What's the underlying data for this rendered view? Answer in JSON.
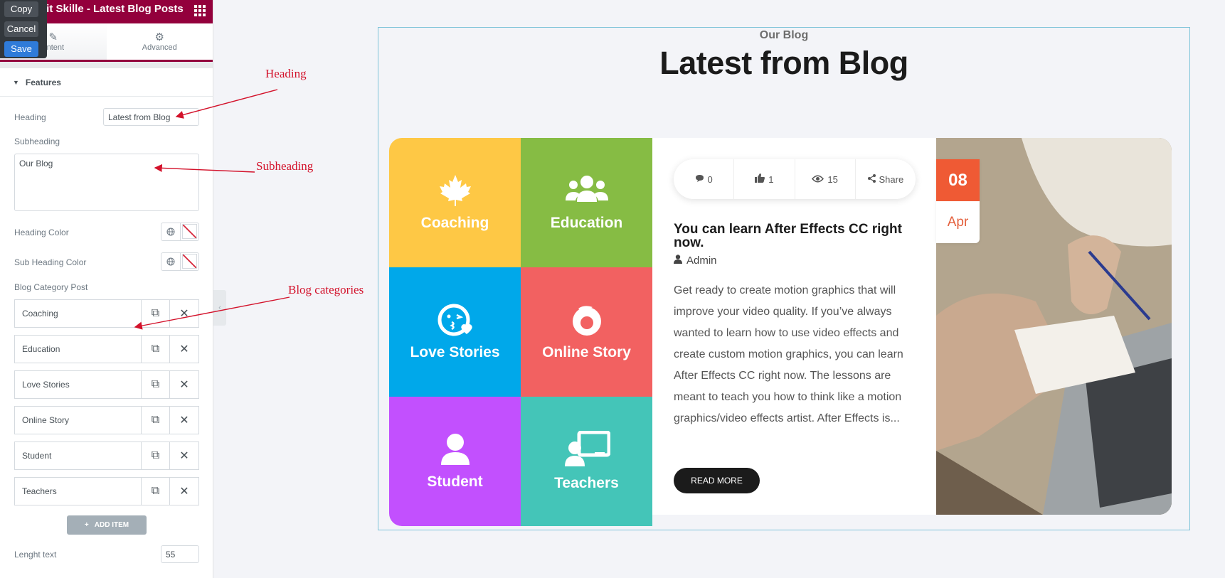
{
  "panel": {
    "title": "Edit Skille - Latest Blog Posts",
    "title_visible": "dit Skille - Latest Blog Posts",
    "action_menu": {
      "copy": "Copy",
      "cancel": "Cancel",
      "save": "Save"
    },
    "tabs": [
      {
        "label": "Content",
        "visible": "ontent"
      },
      {
        "label": "Advanced"
      }
    ],
    "section": "Features",
    "heading_label": "Heading",
    "heading_value": "Latest from Blog",
    "subheading_label": "Subheading",
    "subheading_value": "Our Blog",
    "heading_color_label": "Heading Color",
    "sub_heading_color_label": "Sub Heading Color",
    "blog_category_label": "Blog Category Post",
    "categories": [
      "Coaching",
      "Education",
      "Love Stories",
      "Online Story",
      "Student",
      "Teachers"
    ],
    "add_item": "ADD ITEM",
    "length_label": "Lenght text",
    "length_value": "55"
  },
  "annotations": {
    "heading": "Heading",
    "subheading": "Subheading",
    "blog_categories": "Blog categories"
  },
  "preview": {
    "subheading": "Our Blog",
    "heading": "Latest from Blog",
    "tiles": [
      {
        "label": "Coaching",
        "color": "#fec845",
        "icon": "maple-leaf-icon"
      },
      {
        "label": "Education",
        "color": "#86bc44",
        "icon": "users-icon"
      },
      {
        "label": "Love Stories",
        "color": "#00a8ea",
        "icon": "kiss-emoji-icon"
      },
      {
        "label": "Online Story",
        "color": "#f26161",
        "icon": "firefox-icon"
      },
      {
        "label": "Student",
        "color": "#c250fe",
        "icon": "user-icon"
      },
      {
        "label": "Teachers",
        "color": "#44c5b8",
        "icon": "teacher-icon"
      }
    ],
    "post": {
      "comments": "0",
      "likes": "1",
      "views": "15",
      "share": "Share",
      "title": "You can learn After Effects CC right now.",
      "author": "Admin",
      "excerpt": "Get ready to create motion graphics that will improve your video quality. If you’ve always wanted to learn how to use video effects and create custom motion graphics, you can learn After Effects CC right now. The lessons are meant to teach you how to think like a motion graphics/video effects artist. After Effects is...",
      "read_more": "READ MORE",
      "date_day": "08",
      "date_month": "Apr"
    }
  }
}
